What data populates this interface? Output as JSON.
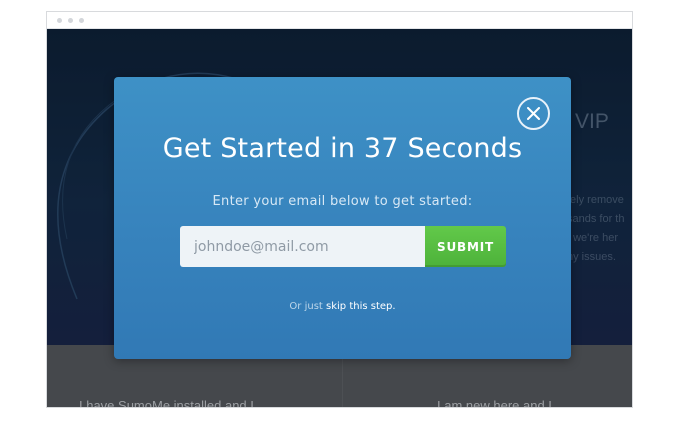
{
  "background_page": {
    "heading_fragment": "VIP",
    "paragraph_fragments": [
      "tely remove",
      "sands for th",
      "t we're her",
      "ny issues."
    ],
    "lower_left_text": "I have SumoMe installed and I",
    "lower_right_text": "I am new here and I"
  },
  "modal": {
    "title": "Get Started in 37 Seconds",
    "subtitle": "Enter your email below to get started:",
    "email_placeholder": "johndoe@mail.com",
    "submit_label": "SUBMIT",
    "skip_prefix": "Or just",
    "skip_link_label": "skip this step."
  },
  "icons": {
    "close": "close-icon"
  },
  "colors": {
    "modal_blue": "#3783bd",
    "submit_green": "#55b940",
    "hero_navy": "#142a44"
  }
}
